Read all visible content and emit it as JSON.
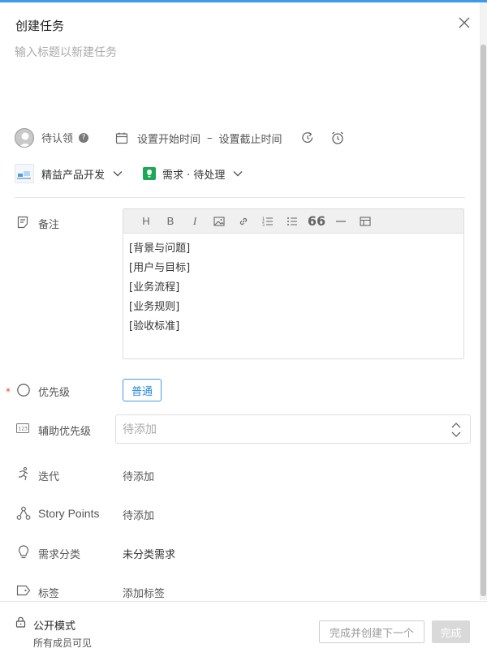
{
  "dialog": {
    "title": "创建任务",
    "title_placeholder": "输入标题以新建任务"
  },
  "meta": {
    "assignee": "待认领",
    "start_time": "设置开始时间",
    "separator": "–",
    "due_time": "设置截止时间",
    "project": "精益产品开发",
    "type_status": "需求 · 待处理",
    "type_color": "#1aaa55"
  },
  "fields": {
    "notes_label": "备注",
    "editor_toolbar": [
      "H",
      "B",
      "I",
      "image",
      "link",
      "ordered-list",
      "bullet-list",
      "quote",
      "divider",
      "table"
    ],
    "editor_lines": [
      "[背景与问题]",
      "[用户与目标]",
      "[业务流程]",
      "[业务规则]",
      "[验收标准]"
    ],
    "priority_label": "优先级",
    "priority_value": "普通",
    "sub_priority_label": "辅助优先级",
    "sub_priority_placeholder": "待添加",
    "iteration_label": "迭代",
    "iteration_value": "待添加",
    "story_points_label": "Story Points",
    "story_points_value": "待添加",
    "category_label": "需求分类",
    "category_value": "未分类需求",
    "tags_label": "标签",
    "tags_value": "添加标签"
  },
  "footer": {
    "mode_title": "公开模式",
    "mode_desc": "所有成员可见",
    "create_next_label": "完成并创建下一个",
    "done_label": "完成"
  },
  "colors": {
    "accent": "#3b9ae8",
    "required": "#e74c3c"
  }
}
